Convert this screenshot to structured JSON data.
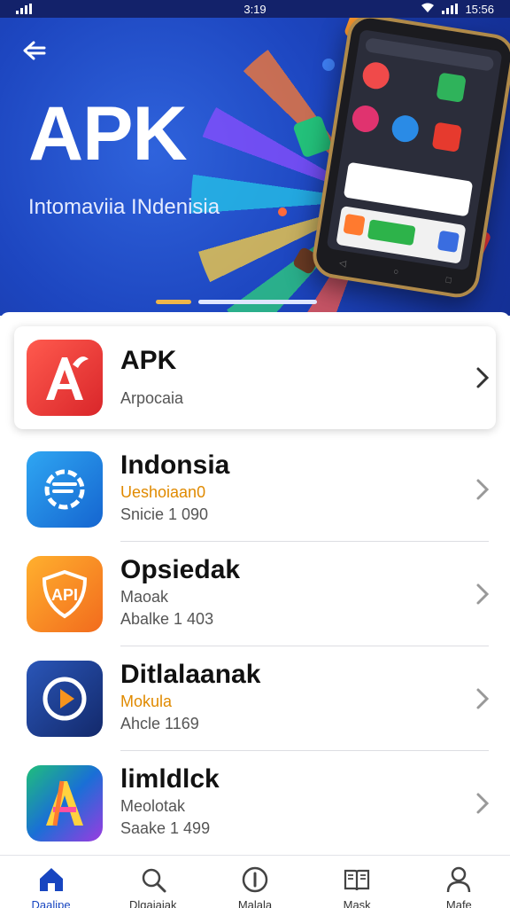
{
  "status_bar": {
    "time": "3:19",
    "right_time": "15:56"
  },
  "hero": {
    "title": "APK",
    "subtitle": "Intomaviia INdenisia"
  },
  "apps": [
    {
      "title": "APK",
      "line1": "Arpocaia",
      "line2": "",
      "featured": true,
      "icon": "apk-a-icon",
      "color": "#e53a35"
    },
    {
      "title": "Indonsia",
      "line1": "Ueshoiaan0",
      "line2": "Snicie 1 090",
      "line1_orange": true,
      "icon": "chat-gear-icon",
      "color": "#1e8ee6"
    },
    {
      "title": "Opsiedak",
      "line1": "Maoak",
      "line2": "Abalke 1 403",
      "icon": "api-shield-icon",
      "color": "#f7941d"
    },
    {
      "title": "Ditlalaanak",
      "line1": "Mokula",
      "line2": "Ahcle 1169",
      "line1_orange": true,
      "icon": "play-circle-icon",
      "color": "#1c3d8f"
    },
    {
      "title": "limldlck",
      "line1": "Meolotak",
      "line2": "Saake 1 499",
      "icon": "colorful-a-icon",
      "color": "#18a86b"
    }
  ],
  "bottom_nav": [
    {
      "label": "Daalipe",
      "icon": "home-icon",
      "active": true
    },
    {
      "label": "Dlgaiaiak",
      "icon": "search-icon",
      "active": false
    },
    {
      "label": "Malala",
      "icon": "info-icon",
      "active": false
    },
    {
      "label": "Mask",
      "icon": "book-icon",
      "active": false
    },
    {
      "label": "Mafe",
      "icon": "profile-icon",
      "active": false
    }
  ],
  "colors": {
    "accent": "#1745c0",
    "hero_bg": "#1d46c0"
  }
}
